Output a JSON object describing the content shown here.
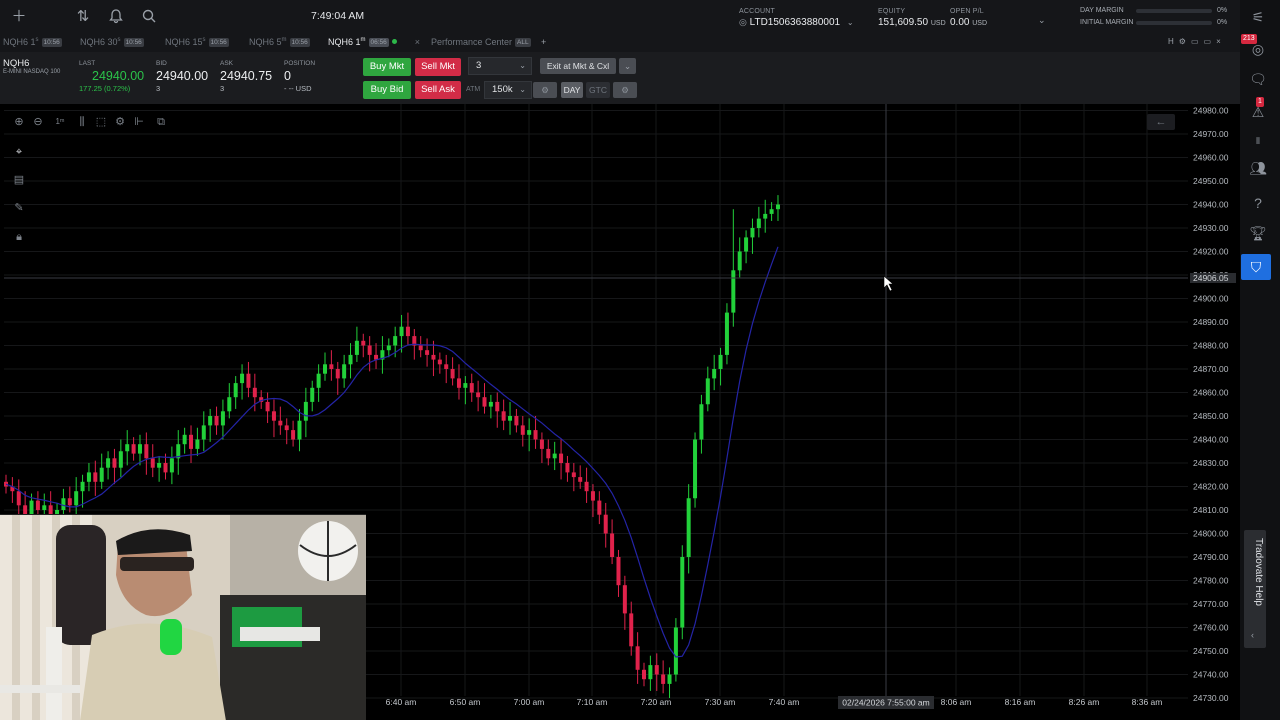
{
  "app": {
    "clock": "7:49:04 AM"
  },
  "account": {
    "account_label": "ACCOUNT",
    "account_id": "LTD1506363880001",
    "equity_label": "EQUITY",
    "equity_value": "151,609.50",
    "equity_unit": "USD",
    "open_pl_label": "OPEN P/L",
    "open_pl_value": "0.00",
    "open_pl_unit": "USD",
    "day_margin_label": "DAY MARGIN",
    "day_margin_pct": "0%",
    "initial_margin_label": "INITIAL MARGIN",
    "initial_margin_pct": "0%"
  },
  "tabs": [
    {
      "label": "NQH6 1",
      "sup": "s",
      "badge": "10:56"
    },
    {
      "label": "NQH6 30",
      "sup": "s",
      "badge": "10:56"
    },
    {
      "label": "NQH6 15",
      "sup": "s",
      "badge": "10:56"
    },
    {
      "label": "NQH6 5",
      "sup": "m",
      "badge": "10:56"
    },
    {
      "label": "NQH6 1",
      "sup": "m",
      "badge": "06:56"
    },
    {
      "label": "Performance Center",
      "badge": "ALL"
    }
  ],
  "quote": {
    "symbol": "NQH6",
    "description": "E-MINI NASDAQ 100",
    "last_label": "LAST",
    "last_value": "24940.00",
    "last_change": "177.25 (0.72%)",
    "bid_label": "BID",
    "bid_value": "24940.00",
    "bid_size": "3",
    "ask_label": "ASK",
    "ask_value": "24940.75",
    "ask_size": "3",
    "position_label": "POSITION",
    "position_value": "0",
    "position_sub": "- -- USD"
  },
  "order_entry": {
    "buy_mkt": "Buy Mkt",
    "sell_mkt": "Sell Mkt",
    "buy_bid": "Buy Bid",
    "sell_ask": "Sell Ask",
    "quantity": "3",
    "exit_label": "Exit at Mkt & Cxl",
    "atm_label": "ATM",
    "atm_value": "150k",
    "day_label": "DAY",
    "gtc_label": "GTC"
  },
  "chart": {
    "crosshair_time_label": "02/24/2026 7:55:00 am",
    "crosshair_price_label": "24906.05",
    "colors": {
      "up": "#22d13a",
      "down": "#e0224b",
      "ma": "#2424a6",
      "grid": "#161719"
    }
  },
  "chart_data": {
    "type": "candlestick",
    "y_ticks": [
      "24980.00",
      "24970.00",
      "24960.00",
      "24950.00",
      "24940.00",
      "24930.00",
      "24920.00",
      "24910.00",
      "24900.00",
      "24890.00",
      "24880.00",
      "24870.00",
      "24860.00",
      "24850.00",
      "24840.00",
      "24830.00",
      "24820.00",
      "24810.00",
      "24800.00",
      "24790.00",
      "24780.00",
      "24770.00",
      "24760.00",
      "24750.00",
      "24740.00",
      "24730.00"
    ],
    "x_ticks": [
      "6:40 am",
      "6:50 am",
      "7:00 am",
      "7:10 am",
      "7:20 am",
      "7:30 am",
      "7:40 am",
      "8:06 am",
      "8:16 am",
      "8:26 am",
      "8:36 am"
    ],
    "ylim": [
      24730,
      24980
    ],
    "candles_close": [
      24820,
      24818,
      24812,
      24808,
      24814,
      24810,
      24812,
      24806,
      24810,
      24815,
      24812,
      24818,
      24822,
      24826,
      24822,
      24828,
      24832,
      24828,
      24835,
      24838,
      24834,
      24838,
      24832,
      24828,
      24830,
      24826,
      24832,
      24838,
      24842,
      24836,
      24840,
      24846,
      24850,
      24846,
      24852,
      24858,
      24864,
      24868,
      24862,
      24858,
      24856,
      24852,
      24848,
      24846,
      24844,
      24840,
      24848,
      24856,
      24862,
      24868,
      24872,
      24870,
      24866,
      24872,
      24876,
      24882,
      24880,
      24876,
      24874,
      24878,
      24880,
      24884,
      24888,
      24884,
      24880,
      24878,
      24876,
      24874,
      24872,
      24870,
      24866,
      24862,
      24864,
      24860,
      24858,
      24854,
      24856,
      24852,
      24848,
      24850,
      24846,
      24842,
      24844,
      24840,
      24836,
      24832,
      24834,
      24830,
      24826,
      24824,
      24822,
      24818,
      24814,
      24808,
      24800,
      24790,
      24778,
      24766,
      24752,
      24742,
      24738,
      24744,
      24740,
      24736,
      24740,
      24760,
      24790,
      24815,
      24840,
      24855,
      24866,
      24870,
      24876,
      24894,
      24912,
      24920,
      24926,
      24930,
      24934,
      24936,
      24938,
      24940
    ]
  },
  "sidebar": {
    "notif_count": "213",
    "alert_count": "1",
    "help_label": "Tradovate Help"
  }
}
